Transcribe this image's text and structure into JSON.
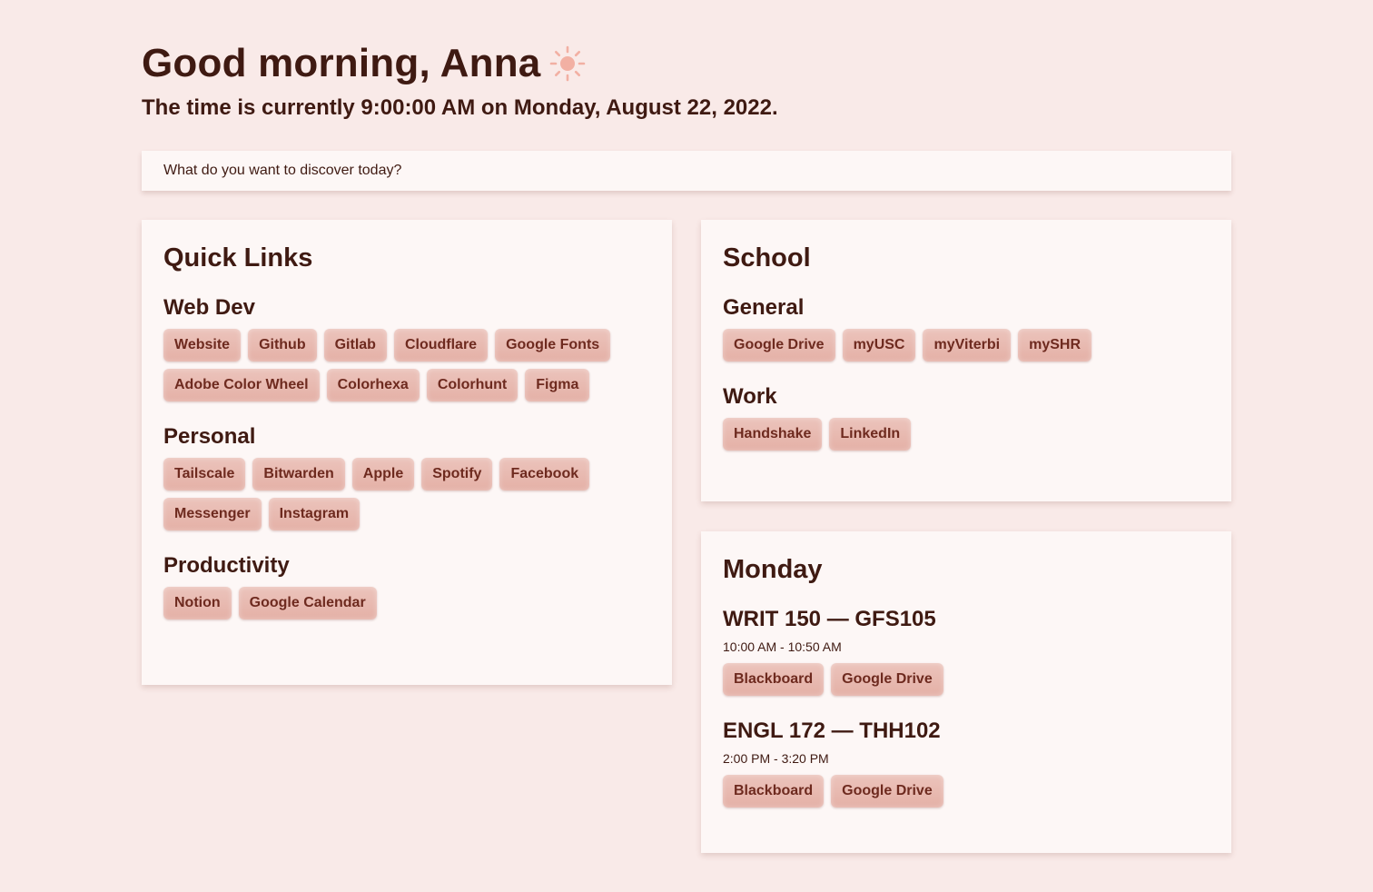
{
  "header": {
    "greeting": "Good morning, Anna",
    "time_line": "The time is currently 9:00:00 AM on Monday, August 22, 2022."
  },
  "search": {
    "placeholder": "What do you want to discover today?"
  },
  "quick_links": {
    "title": "Quick Links",
    "web_dev": {
      "title": "Web Dev",
      "links": [
        "Website",
        "Github",
        "Gitlab",
        "Cloudflare",
        "Google Fonts",
        "Adobe Color Wheel",
        "Colorhexa",
        "Colorhunt",
        "Figma"
      ]
    },
    "personal": {
      "title": "Personal",
      "links": [
        "Tailscale",
        "Bitwarden",
        "Apple",
        "Spotify",
        "Facebook",
        "Messenger",
        "Instagram"
      ]
    },
    "productivity": {
      "title": "Productivity",
      "links": [
        "Notion",
        "Google Calendar"
      ]
    }
  },
  "school": {
    "title": "School",
    "general": {
      "title": "General",
      "links": [
        "Google Drive",
        "myUSC",
        "myViterbi",
        "mySHR"
      ]
    },
    "work": {
      "title": "Work",
      "links": [
        "Handshake",
        "LinkedIn"
      ]
    }
  },
  "schedule": {
    "title": "Monday",
    "classes": [
      {
        "name": "WRIT 150 — GFS105",
        "time": "10:00 AM - 10:50 AM",
        "links": [
          "Blackboard",
          "Google Drive"
        ]
      },
      {
        "name": "ENGL 172 — THH102",
        "time": "2:00 PM - 3:20 PM",
        "links": [
          "Blackboard",
          "Google Drive"
        ]
      }
    ]
  },
  "icons": {
    "greeting_icon": "sun-icon"
  },
  "colors": {
    "background": "#f9eae8",
    "card": "#fdf7f6",
    "text": "#3f1a12",
    "chip": "#e8bbb2",
    "chip_text": "#6e2a1f",
    "sun": "#f2b0a3"
  }
}
